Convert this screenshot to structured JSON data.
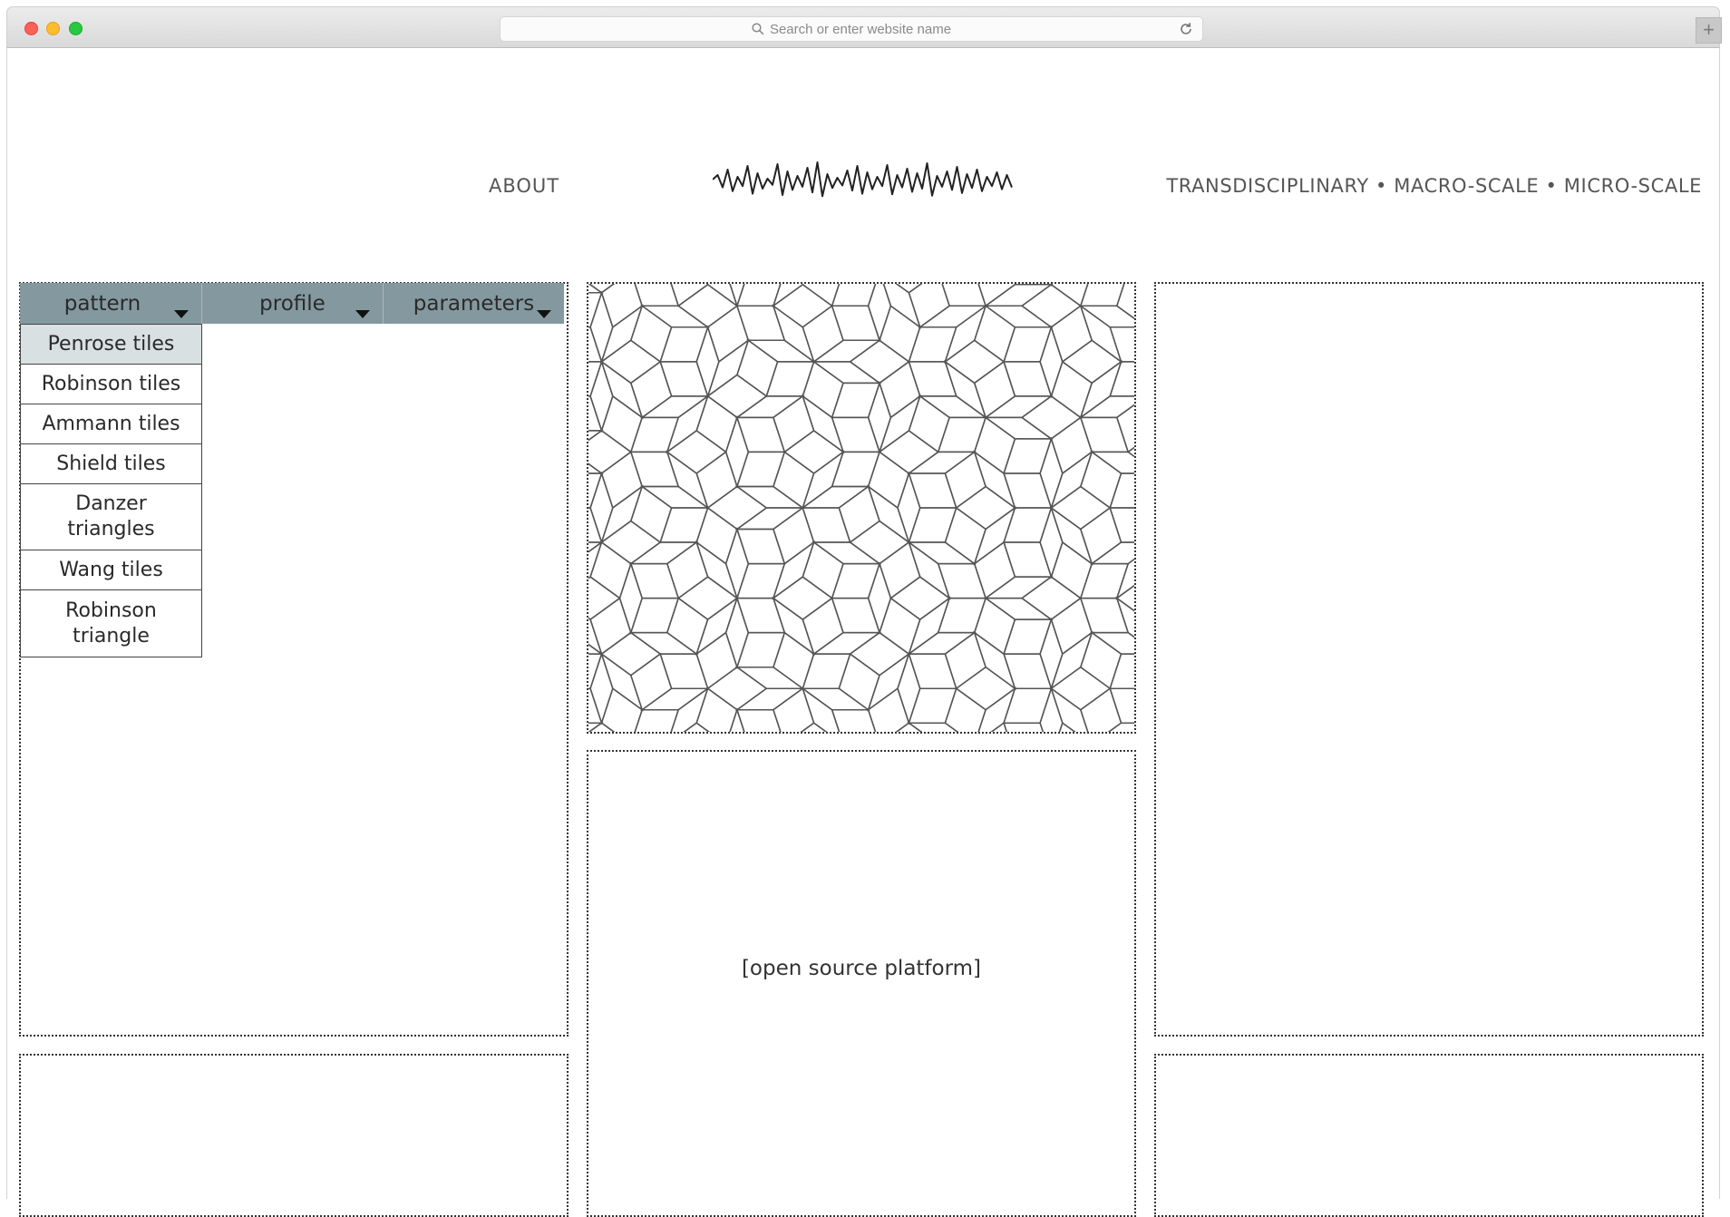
{
  "browser": {
    "address_placeholder": "Search or enter website name",
    "new_tab_label": "+"
  },
  "header": {
    "about_label": "ABOUT",
    "scales_label": "TRANSDISCIPLINARY • MACRO-SCALE • MICRO-SCALE",
    "logo_icon": "waveform-logo-icon"
  },
  "menu": {
    "tabs": [
      {
        "label": "pattern",
        "icon": "caret-down-icon"
      },
      {
        "label": "profile",
        "icon": "caret-down-icon"
      },
      {
        "label": "parameters",
        "icon": "caret-down-icon"
      }
    ],
    "pattern_options": [
      {
        "label": "Penrose tiles",
        "selected": true
      },
      {
        "label": "Robinson tiles",
        "selected": false
      },
      {
        "label": "Ammann tiles",
        "selected": false
      },
      {
        "label": "Shield tiles",
        "selected": false
      },
      {
        "label": "Danzer triangles",
        "selected": false
      },
      {
        "label": "Wang tiles",
        "selected": false
      },
      {
        "label": "Robinson triangle",
        "selected": false
      }
    ]
  },
  "main": {
    "platform_label": "[open source platform]"
  },
  "colors": {
    "menu_bar": "#84999f",
    "selected_option": "#d9e0e2",
    "panel_border": "#333333",
    "tiling_stroke": "#555555"
  }
}
